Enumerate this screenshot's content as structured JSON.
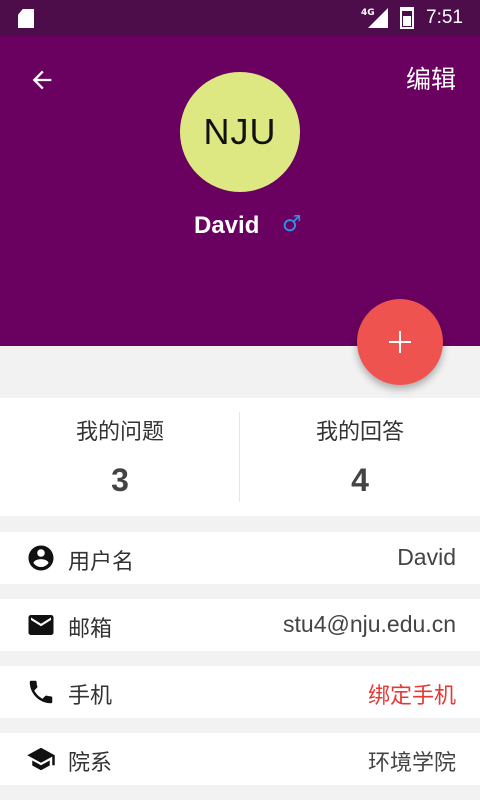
{
  "status_bar": {
    "network": "4G",
    "time": "7:51"
  },
  "header": {
    "edit_label": "编辑",
    "avatar_text": "NJU",
    "user_name": "David",
    "gender_symbol": "♂"
  },
  "stats": [
    {
      "label": "我的问题",
      "count": "3"
    },
    {
      "label": "我的回答",
      "count": "4"
    }
  ],
  "info_rows": [
    {
      "label": "用户名",
      "value": "David",
      "icon": "account-circle-icon"
    },
    {
      "label": "邮箱",
      "value": "stu4@nju.edu.cn",
      "icon": "mail-icon"
    },
    {
      "label": "手机",
      "value": "绑定手机",
      "icon": "phone-icon"
    },
    {
      "label": "院系",
      "value": "环境学院",
      "icon": "school-icon"
    }
  ],
  "colors": {
    "header_bg": "#6a005f",
    "status_bar_bg": "#4d0d4a",
    "avatar_bg": "#dde882",
    "fab": "#ef5350",
    "accent_text": "#e53935",
    "gender_icon": "#2f8ee5"
  }
}
